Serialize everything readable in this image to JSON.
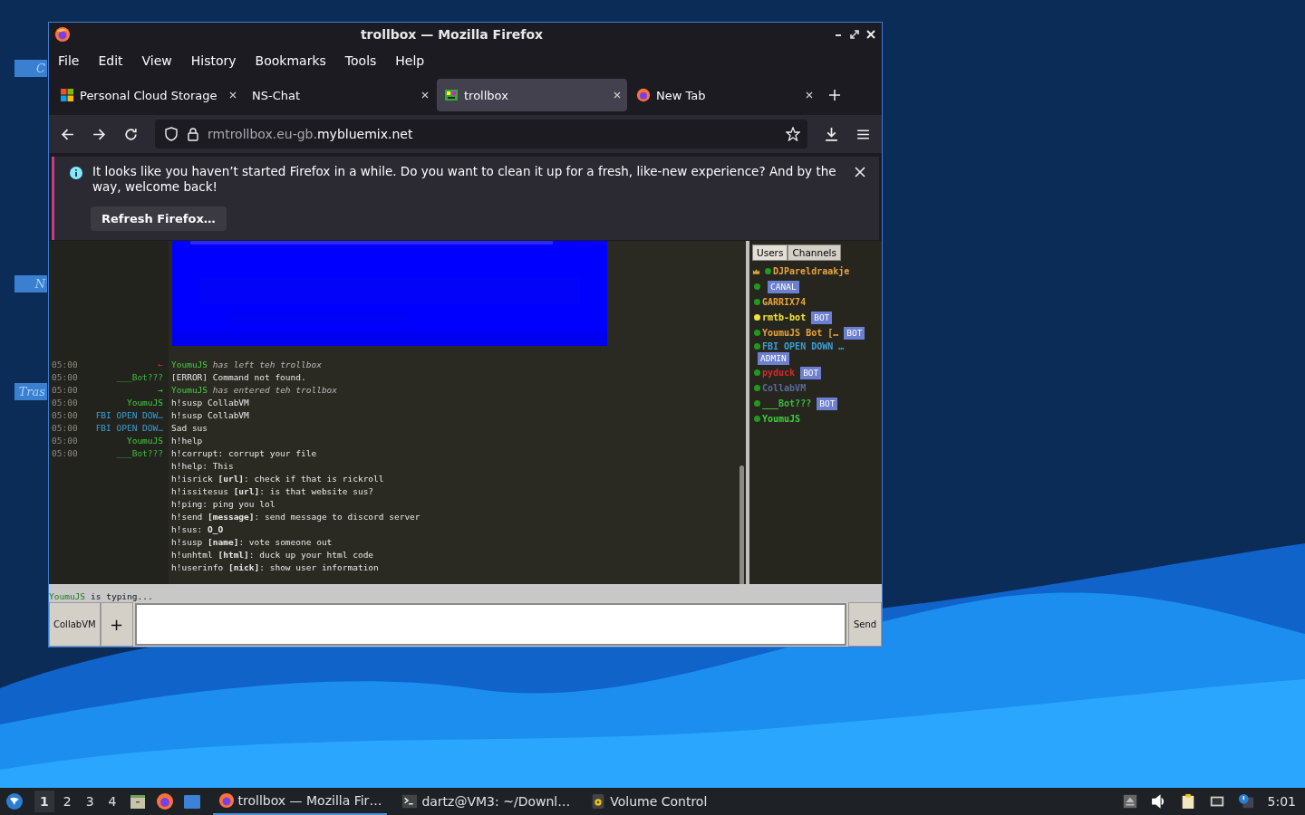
{
  "desktop": {
    "icons": [
      {
        "label": "C"
      },
      {
        "label": "N"
      },
      {
        "label": "Tras"
      }
    ]
  },
  "window": {
    "title": "trollbox — Mozilla Firefox"
  },
  "menu": [
    "File",
    "Edit",
    "View",
    "History",
    "Bookmarks",
    "Tools",
    "Help"
  ],
  "tabs": [
    {
      "label": "Personal Cloud Storage",
      "selected": false
    },
    {
      "label": "NS-Chat",
      "selected": false
    },
    {
      "label": "trollbox",
      "selected": true
    },
    {
      "label": "New Tab",
      "selected": false
    }
  ],
  "address": {
    "host_prefix": "rmtrollbox.eu-gb.",
    "host_domain": "mybluemix.net"
  },
  "notification": {
    "text": "It looks like you haven’t started Firefox in a while. Do you want to clean it up for a fresh, like-new experience? And by the way, welcome back!",
    "button": "Refresh Firefox…"
  },
  "chat": {
    "messages": [
      {
        "kind": "leave",
        "time": "05:00",
        "arrow": "←",
        "nick": "YoumuJS",
        "color": "#3fcf3f",
        "lines": [
          "has left teh trollbox"
        ]
      },
      {
        "kind": "message",
        "time": "05:00",
        "nick": "___Bot???",
        "color": "#3fb83f",
        "lines": [
          "[ERROR] Command not found."
        ]
      },
      {
        "kind": "join",
        "time": "05:00",
        "arrow": "→",
        "nick": "YoumuJS",
        "color": "#3fcf3f",
        "lines": [
          "has entered teh trollbox"
        ]
      },
      {
        "kind": "message",
        "time": "05:00",
        "nick": "YoumuJS",
        "color": "#3fcf3f",
        "lines": [
          "h!susp CollabVM"
        ]
      },
      {
        "kind": "message",
        "time": "05:00",
        "nick": "FBI OPEN DOW…",
        "color": "#3a9fd6",
        "lines": [
          "h!susp CollabVM"
        ]
      },
      {
        "kind": "message",
        "time": "05:00",
        "nick": "FBI OPEN DOW…",
        "color": "#3a9fd6",
        "lines": [
          "Sad sus"
        ]
      },
      {
        "kind": "message",
        "time": "05:00",
        "nick": "YoumuJS",
        "color": "#3fcf3f",
        "lines": [
          "h!help"
        ]
      },
      {
        "kind": "message",
        "time": "05:00",
        "nick": "___Bot???",
        "color": "#3fb83f",
        "lines": [
          "h!corrupt: corrupt your file",
          "h!help: This",
          "h!isrick **[url]**: check if that is rickroll",
          "h!issitesus **[url]**: is that website sus?",
          "h!ping: ping you lol",
          "h!send **[message]**: send message to discord server",
          "h!sus: **O_O**",
          "h!susp **[name]**: vote someone out",
          "h!unhtml **[html]**: duck up your html code",
          "h!userinfo **[nick]**: show user information"
        ]
      }
    ]
  },
  "userlist": {
    "tabs": [
      {
        "label": "Users",
        "selected": true
      },
      {
        "label": "Channels",
        "selected": false
      }
    ],
    "users": [
      {
        "name": "DJPareldraakje",
        "color": "#e8a33a",
        "status": {
          "color": "#1f9a1f"
        },
        "owner": true
      },
      {
        "status": {
          "color": "#1f9a1f"
        },
        "badge": "CANAL",
        "owner": false
      },
      {
        "name": "GARRIX74",
        "color": "#e8a33a",
        "status": {
          "color": "#1f9a1f"
        },
        "owner": false
      },
      {
        "name": "rmtb-bot",
        "color": "#f2e33a",
        "status": {
          "color": "#f2e33a"
        },
        "badge": "BOT",
        "owner": false
      },
      {
        "name": "YoumuJS Bot […",
        "color": "#e8a33a",
        "status": {
          "color": "#1f9a1f"
        },
        "badge": "BOT",
        "owner": false
      },
      {
        "name": "FBI OPEN DOWN …",
        "color": "#3a9fd6",
        "status": {
          "color": "#1f9a1f"
        },
        "badge": "ADMIN",
        "owner": false
      },
      {
        "name": "pyduck",
        "color": "#d42a2a",
        "status": {
          "color": "#1f9a1f"
        },
        "badge": "BOT",
        "owner": false
      },
      {
        "name": "CollabVM",
        "color": "#5a6a9a",
        "status": {
          "color": "#1f9a1f"
        },
        "owner": false
      },
      {
        "name": "___Bot???",
        "color": "#3fb83f",
        "status": {
          "color": "#1f9a1f"
        },
        "badge": "BOT",
        "owner": false
      },
      {
        "name": "YoumuJS",
        "color": "#3fcf3f",
        "status": {
          "color": "#1f9a1f"
        },
        "owner": false
      }
    ]
  },
  "typing": {
    "nick": "YoumuJS",
    "text": "is typing..."
  },
  "composer": {
    "channel_button": "CollabVM",
    "add_button": "+",
    "send_button": "Send"
  },
  "taskbar": {
    "workspaces": [
      {
        "label": "1",
        "selected": true
      },
      {
        "label": "2",
        "selected": false
      },
      {
        "label": "3",
        "selected": false
      },
      {
        "label": "4",
        "selected": false
      }
    ],
    "tasks": [
      {
        "label": "trollbox — Mozilla Fir…",
        "selected": true
      },
      {
        "label": "dartz@VM3: ~/Downl…",
        "selected": false
      },
      {
        "label": "Volume Control",
        "selected": false
      }
    ],
    "clock": "5:01"
  }
}
